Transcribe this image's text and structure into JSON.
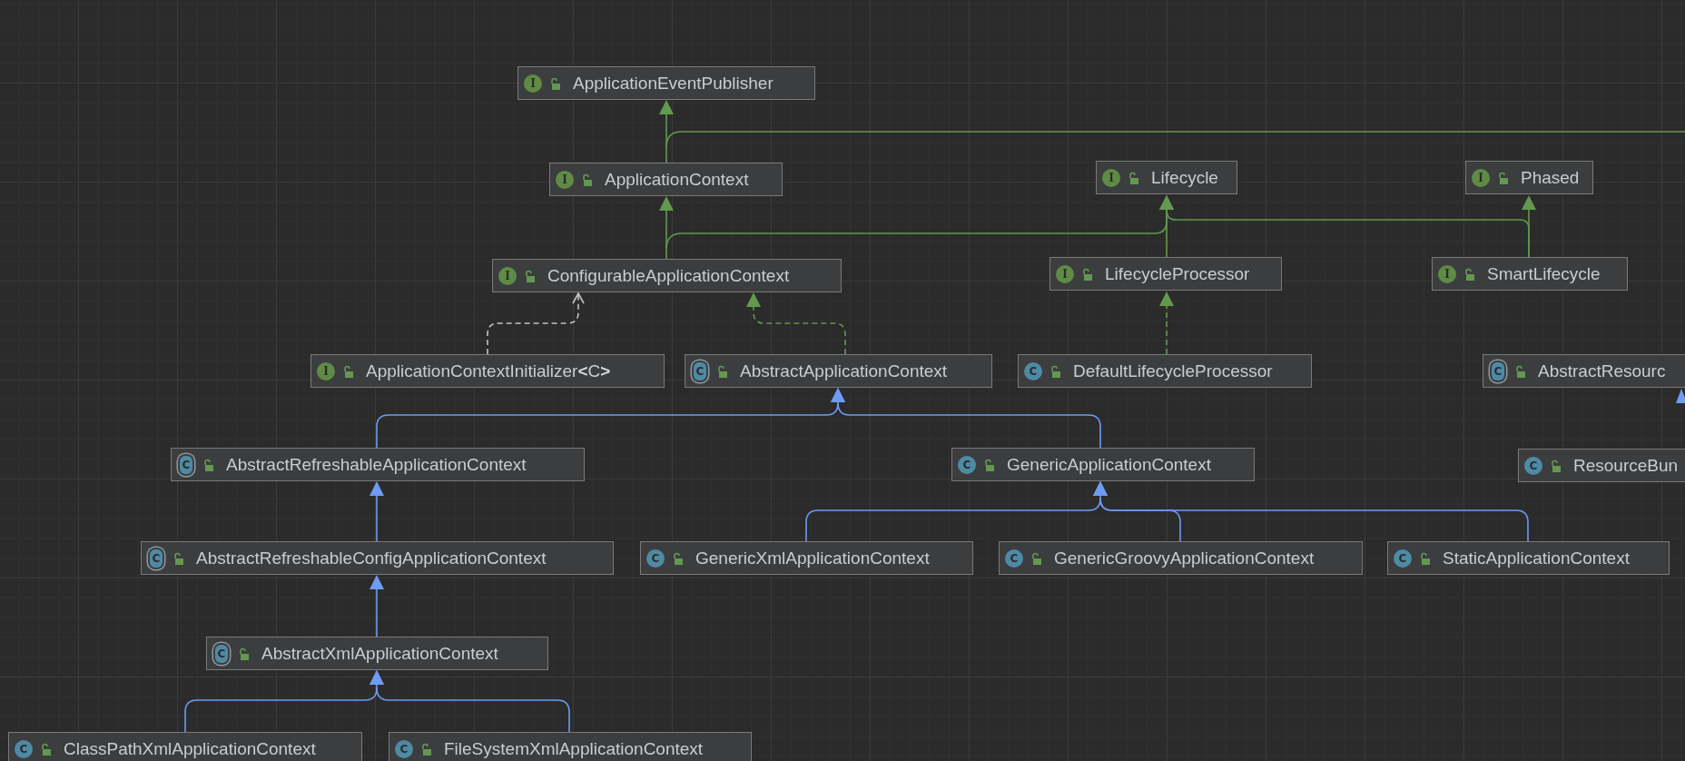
{
  "diagram": {
    "nodes": [
      {
        "name": "ApplicationEventPublisher",
        "kind": "interface",
        "badge": "I"
      },
      {
        "name": "ApplicationContext",
        "kind": "interface",
        "badge": "I"
      },
      {
        "name": "Lifecycle",
        "kind": "interface",
        "badge": "I"
      },
      {
        "name": "Phased",
        "kind": "interface",
        "badge": "I"
      },
      {
        "name": "ConfigurableApplicationContext",
        "kind": "interface",
        "badge": "I"
      },
      {
        "name": "LifecycleProcessor",
        "kind": "interface",
        "badge": "I"
      },
      {
        "name": "SmartLifecycle",
        "kind": "interface",
        "badge": "I"
      },
      {
        "name": "ApplicationContextInitializer**<**C**>**",
        "kind": "interface",
        "badge": "I"
      },
      {
        "name": "AbstractApplicationContext",
        "kind": "abstract",
        "badge": "C"
      },
      {
        "name": "DefaultLifecycleProcessor",
        "kind": "class",
        "badge": "C"
      },
      {
        "name": "AbstractResourc",
        "kind": "abstract",
        "badge": "C"
      },
      {
        "name": "AbstractRefreshableApplicationContext",
        "kind": "abstract",
        "badge": "C"
      },
      {
        "name": "GenericApplicationContext",
        "kind": "class",
        "badge": "C"
      },
      {
        "name": "ResourceBun",
        "kind": "class",
        "badge": "C"
      },
      {
        "name": "AbstractRefreshableConfigApplicationContext",
        "kind": "abstract",
        "badge": "C"
      },
      {
        "name": "GenericXmlApplicationContext",
        "kind": "class",
        "badge": "C"
      },
      {
        "name": "GenericGroovyApplicationContext",
        "kind": "class",
        "badge": "C"
      },
      {
        "name": "StaticApplicationContext",
        "kind": "class",
        "badge": "C"
      },
      {
        "name": "AbstractXmlApplicationContext",
        "kind": "abstract",
        "badge": "C"
      },
      {
        "name": "ClassPathXmlApplicationContext",
        "kind": "class",
        "badge": "C"
      },
      {
        "name": "FileSystemXmlApplicationContext",
        "kind": "class",
        "badge": "C"
      }
    ]
  }
}
